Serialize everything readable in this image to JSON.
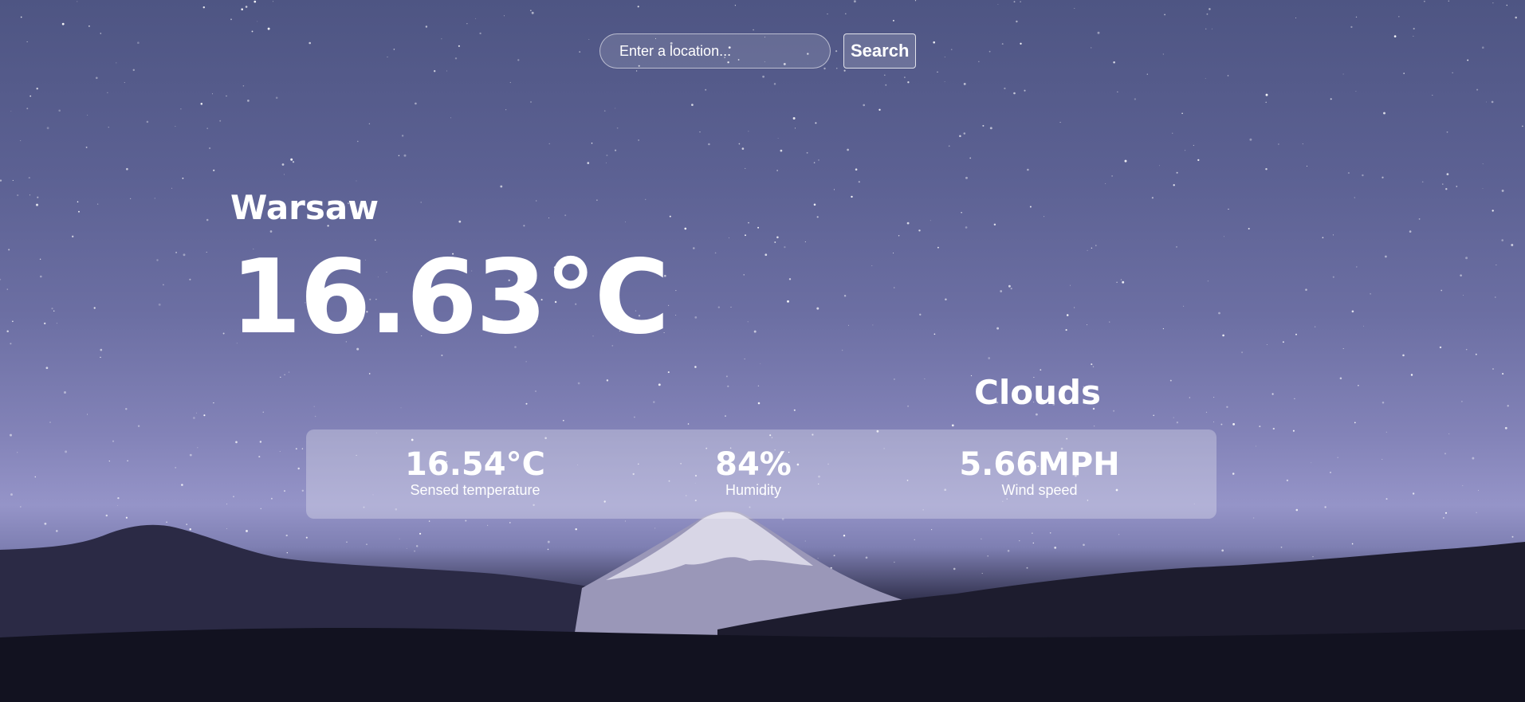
{
  "search": {
    "placeholder": "Enter a location...",
    "value": "",
    "button_label": "Search"
  },
  "weather": {
    "city": "Warsaw",
    "temperature": "16.63°C",
    "condition": "Clouds",
    "details": [
      {
        "value": "16.54°C",
        "label": "Sensed temperature"
      },
      {
        "value": "84%",
        "label": "Humidity"
      },
      {
        "value": "5.66MPH",
        "label": "Wind speed"
      }
    ]
  },
  "background": {
    "description_icon": "night-sky-mountain-image",
    "sky_color": "#5c6193",
    "mountain_snow_color": "#d8d6e6",
    "foreground_color": "#14141f"
  }
}
